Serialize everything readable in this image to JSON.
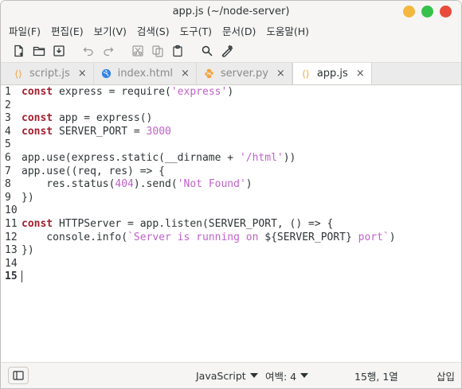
{
  "window": {
    "title": "app.js (~/node-server)"
  },
  "menu": [
    "파일(F)",
    "편집(E)",
    "보기(V)",
    "검색(S)",
    "도구(T)",
    "문서(D)",
    "도움말(H)"
  ],
  "toolbar": [
    "new-document-icon",
    "open-folder-icon",
    "save-icon",
    "undo-icon",
    "redo-icon",
    "cut-icon",
    "copy-icon",
    "paste-icon",
    "search-icon",
    "spellcheck-icon"
  ],
  "tabs": [
    {
      "label": "script.js",
      "icon": "js-icon",
      "close": "×"
    },
    {
      "label": "index.html",
      "icon": "globe-icon",
      "close": "×"
    },
    {
      "label": "server.py",
      "icon": "python-icon",
      "close": "×"
    },
    {
      "label": "app.js",
      "icon": "js-icon",
      "close": "×",
      "active": true
    }
  ],
  "code": {
    "line_numbers": [
      "1",
      "2",
      "3",
      "4",
      "5",
      "6",
      "7",
      "8",
      "9",
      "10",
      "11",
      "12",
      "13",
      "14",
      "15"
    ],
    "lines": [
      "const express = require('express')",
      "",
      "const app = express()",
      "const SERVER_PORT = 3000",
      "",
      "app.use(express.static(__dirname + '/html'))",
      "app.use((req, res) => {",
      "    res.status(404).send('Not Found')",
      "})",
      "",
      "const HTTPServer = app.listen(SERVER_PORT, () => {",
      "    console.info(`Server is running on ${SERVER_PORT} port`)",
      "})",
      "",
      ""
    ]
  },
  "status": {
    "language": "JavaScript",
    "tab_width": "여백: 4",
    "position": "15행, 1열",
    "mode": "삽입"
  },
  "colors": {
    "keyword": "#a51d2d",
    "string": "#c061cb",
    "accent": "#f4a23a"
  }
}
